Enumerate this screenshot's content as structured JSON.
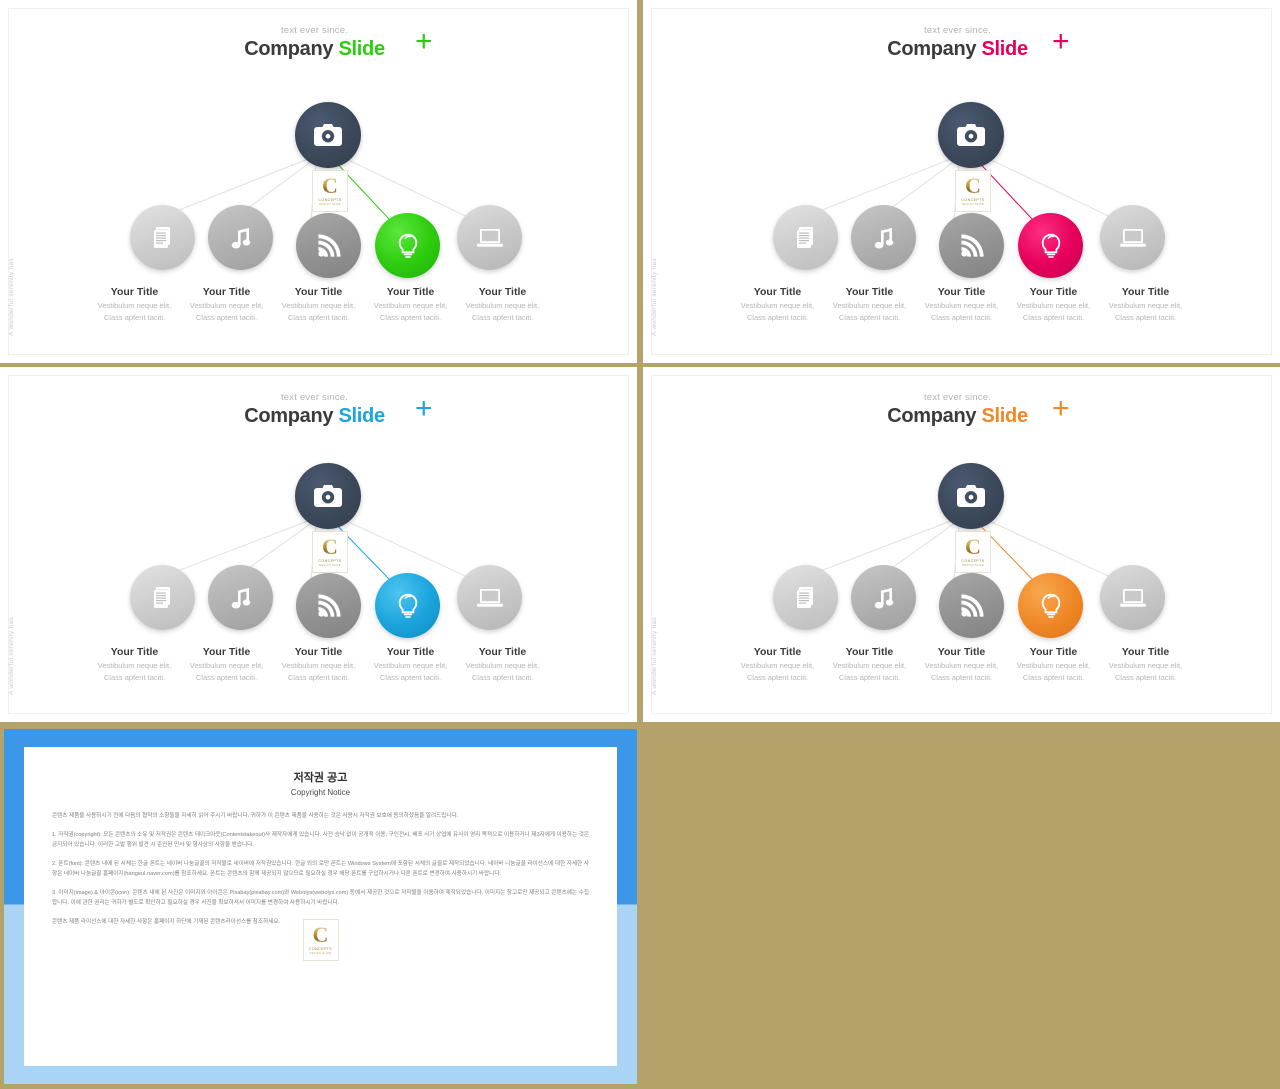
{
  "theme": {
    "background_color": "#b3a36a",
    "node_dark_color": "#3b4859"
  },
  "slides": [
    {
      "id": "slide-green",
      "accent_color": "#2ecc0f",
      "header": {
        "subtitle": "text ever since.",
        "title_dark": "Company",
        "title_accent": "Slide"
      },
      "side_text": "A wonderful serenity has",
      "center_node": {
        "icon": "camera-icon"
      },
      "watermark": {
        "letter": "C",
        "line1": "CONCEPTS",
        "line2": "DESIGN  SLIDE"
      },
      "nodes": [
        {
          "icon": "documents-icon",
          "title": "Your Title",
          "desc_line1": "Vestibulum neque elit,",
          "desc_line2": "Class aptent taciti.",
          "highlighted": false
        },
        {
          "icon": "music-note-icon",
          "title": "Your Title",
          "desc_line1": "Vestibulum neque elit,",
          "desc_line2": "Class aptent taciti.",
          "highlighted": false
        },
        {
          "icon": "rss-signal-icon",
          "title": "Your Title",
          "desc_line1": "Vestibulum neque elit,",
          "desc_line2": "Class aptent taciti.",
          "highlighted": false
        },
        {
          "icon": "lightbulb-icon",
          "title": "Your Title",
          "desc_line1": "Vestibulum neque elit,",
          "desc_line2": "Class aptent taciti.",
          "highlighted": true
        },
        {
          "icon": "laptop-icon",
          "title": "Your Title",
          "desc_line1": "Vestibulum neque elit,",
          "desc_line2": "Class aptent taciti.",
          "highlighted": false
        }
      ]
    },
    {
      "id": "slide-pink",
      "accent_color": "#e6005c",
      "header": {
        "subtitle": "text ever since.",
        "title_dark": "Company",
        "title_accent": "Slide"
      },
      "side_text": "A wonderful serenity has",
      "center_node": {
        "icon": "camera-icon"
      },
      "watermark": {
        "letter": "C",
        "line1": "CONCEPTS",
        "line2": "DESIGN  SLIDE"
      },
      "nodes": [
        {
          "icon": "documents-icon",
          "title": "Your Title",
          "desc_line1": "Vestibulum neque elit,",
          "desc_line2": "Class aptent taciti.",
          "highlighted": false
        },
        {
          "icon": "music-note-icon",
          "title": "Your Title",
          "desc_line1": "Vestibulum neque elit,",
          "desc_line2": "Class aptent taciti.",
          "highlighted": false
        },
        {
          "icon": "rss-signal-icon",
          "title": "Your Title",
          "desc_line1": "Vestibulum neque elit,",
          "desc_line2": "Class aptent taciti.",
          "highlighted": false
        },
        {
          "icon": "lightbulb-icon",
          "title": "Your Title",
          "desc_line1": "Vestibulum neque elit,",
          "desc_line2": "Class aptent taciti.",
          "highlighted": true
        },
        {
          "icon": "laptop-icon",
          "title": "Your Title",
          "desc_line1": "Vestibulum neque elit,",
          "desc_line2": "Class aptent taciti.",
          "highlighted": false
        }
      ]
    },
    {
      "id": "slide-blue",
      "accent_color": "#1ba5dc",
      "header": {
        "subtitle": "text ever since.",
        "title_dark": "Company",
        "title_accent": "Slide"
      },
      "side_text": "A wonderful serenity has",
      "center_node": {
        "icon": "camera-icon"
      },
      "watermark": {
        "letter": "C",
        "line1": "CONCEPTS",
        "line2": "DESIGN  SLIDE"
      },
      "nodes": [
        {
          "icon": "documents-icon",
          "title": "Your Title",
          "desc_line1": "Vestibulum neque elit,",
          "desc_line2": "Class aptent taciti.",
          "highlighted": false
        },
        {
          "icon": "music-note-icon",
          "title": "Your Title",
          "desc_line1": "Vestibulum neque elit,",
          "desc_line2": "Class aptent taciti.",
          "highlighted": false
        },
        {
          "icon": "rss-signal-icon",
          "title": "Your Title",
          "desc_line1": "Vestibulum neque elit,",
          "desc_line2": "Class aptent taciti.",
          "highlighted": false
        },
        {
          "icon": "lightbulb-icon",
          "title": "Your Title",
          "desc_line1": "Vestibulum neque elit,",
          "desc_line2": "Class aptent taciti.",
          "highlighted": true
        },
        {
          "icon": "laptop-icon",
          "title": "Your Title",
          "desc_line1": "Vestibulum neque elit,",
          "desc_line2": "Class aptent taciti.",
          "highlighted": false
        }
      ]
    },
    {
      "id": "slide-orange",
      "accent_color": "#f08828",
      "header": {
        "subtitle": "text ever since.",
        "title_dark": "Company",
        "title_accent": "Slide"
      },
      "side_text": "A wonderful serenity has",
      "center_node": {
        "icon": "camera-icon"
      },
      "watermark": {
        "letter": "C",
        "line1": "CONCEPTS",
        "line2": "DESIGN  SLIDE"
      },
      "nodes": [
        {
          "icon": "documents-icon",
          "title": "Your Title",
          "desc_line1": "Vestibulum neque elit,",
          "desc_line2": "Class aptent taciti.",
          "highlighted": false
        },
        {
          "icon": "music-note-icon",
          "title": "Your Title",
          "desc_line1": "Vestibulum neque elit,",
          "desc_line2": "Class aptent taciti.",
          "highlighted": false
        },
        {
          "icon": "rss-signal-icon",
          "title": "Your Title",
          "desc_line1": "Vestibulum neque elit,",
          "desc_line2": "Class aptent taciti.",
          "highlighted": false
        },
        {
          "icon": "lightbulb-icon",
          "title": "Your Title",
          "desc_line1": "Vestibulum neque elit,",
          "desc_line2": "Class aptent taciti.",
          "highlighted": true
        },
        {
          "icon": "laptop-icon",
          "title": "Your Title",
          "desc_line1": "Vestibulum neque elit,",
          "desc_line2": "Class aptent taciti.",
          "highlighted": false
        }
      ]
    }
  ],
  "copyright_panel": {
    "title_ko": "저작권 공고",
    "title_en": "Copyright Notice",
    "intro": "콘텐츠 제품을 사용하시기 전에 다음의 협약의 소항들을 자세히 읽어 주시기 바랍니다. 귀하가 이 콘텐츠 제품을 사용하는 것은 사용시 저작권 보호에 동의하셨음을 알려드립니다.",
    "section1": "1. 저작권(copyright): 모든 콘텐츠의 소유 및 저작권은 콘텐츠 테이크아웃(Contentstakeout)사 제작자에게 있습니다. 사전 승낙 없이 공개적 이용, 구인전시, 배포 사기 상업에 유사이 영리 목적으로 이용하거나 제3자에게 이용하는 것은 금지되어 있습니다. 이러한 고발 행위 발견 시 준인된 민사 및 형사상의 사항을 받습니다.",
    "section2": "2. 폰트(font): 콘텐츠 내에 된 서체는 한글 폰트는 네이버 나눔글꼴의 저작물로 네이버에 저작권있습니다. 한글 외의 로만 폰트는 Windows System에 포함된 서체의 글꼴로 제작되었습니다. 네이버 나눔글꼴 라이선스에 대한 자세한 사항은 네이버 나눔글꼴 홈페이지(hangeul.naver.com)를 참조하세요. 폰트는 콘텐츠의 함께 제공되지 않으므로 필요하실 경우 해당 폰트를 구입하시거나 다른 폰트로 변경하여 사용하시기 바랍니다.",
    "section3": "3. 이미지(image) & 아이콘(icon): 콘텐츠 내에 된 사진은 이미지와 아이콘은 Pixabay(pixabay.com)와 Webolys(webolys.com) 등에서 제공한 것으로 저작물을 이용하여 제작되었습니다. 이미지는 참고로만 제공되고 콘텐츠에는 수집합니다. 이에 관한 권리는 귀하가 별도로 확인하고 필요하실 경우 사진을 확보하셔서 이미지를 변경하여 사용하시기 바랍니다.",
    "footer": "콘텐츠 제품 라이선스에 대한 자세한 사항은 홈페이지 하단에 기재된 콘텐츠라이선스를 참조하세요.",
    "watermark": {
      "letter": "C",
      "line1": "CONCEPTS",
      "line2": "DESIGN  SLIDE"
    }
  }
}
